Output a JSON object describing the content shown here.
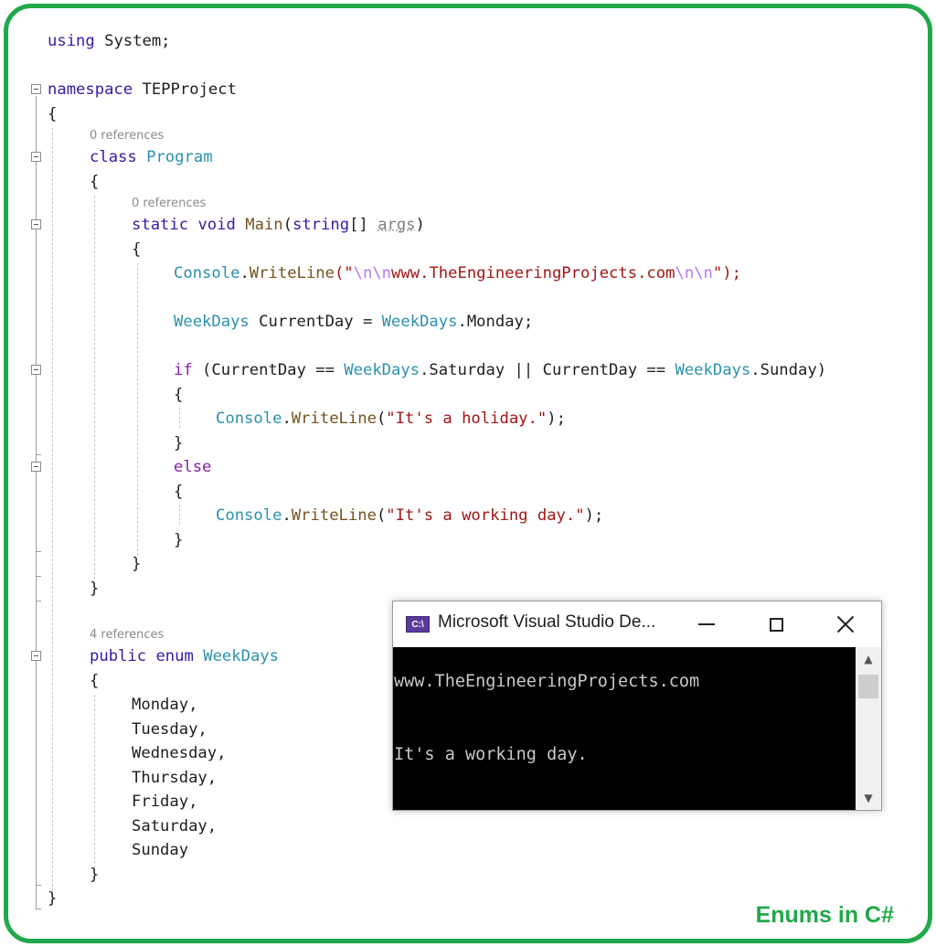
{
  "code": {
    "line_using": [
      "using",
      " System;"
    ],
    "line_namespace": [
      "namespace",
      " TEPProject"
    ],
    "open_brace": "{",
    "close_brace": "}",
    "codelens_program": "0 references",
    "line_class": [
      "class",
      " ",
      "Program"
    ],
    "codelens_main": "0 references",
    "line_main": [
      "static",
      " ",
      "void",
      " ",
      "Main",
      "(",
      "string",
      "[] ",
      "args",
      ")"
    ],
    "line_writeline1": [
      "Console",
      ".",
      "WriteLine",
      "(\"",
      "\\n\\n",
      "www.TheEngineeringProjects.com",
      "\\n\\n",
      "\");"
    ],
    "line_currentday": [
      "WeekDays",
      " CurrentDay = ",
      "WeekDays",
      ".Monday;"
    ],
    "line_if": [
      "if",
      " (CurrentDay == ",
      "WeekDays",
      ".Saturday || CurrentDay == ",
      "WeekDays",
      ".Sunday)"
    ],
    "line_writeline2": [
      "Console",
      ".",
      "WriteLine",
      "(",
      "\"It's a holiday.\"",
      ");"
    ],
    "line_else": "else",
    "line_writeline3": [
      "Console",
      ".",
      "WriteLine",
      "(",
      "\"It's a working day.\"",
      ");"
    ],
    "codelens_enum": "4 references",
    "line_enum": [
      "public",
      " ",
      "enum",
      " ",
      "WeekDays"
    ],
    "enum_members": [
      "Monday,",
      "Tuesday,",
      "Wednesday,",
      "Thursday,",
      "Friday,",
      "Saturday,",
      "Sunday"
    ]
  },
  "console_window": {
    "app_icon_text": "C:\\",
    "title": "Microsoft Visual Studio De...",
    "output_lines": [
      "www.TheEngineeringProjects.com",
      "It's a working day."
    ],
    "scroll_up": "^",
    "scroll_down": "v"
  },
  "footer": {
    "title": "Enums in C#"
  },
  "colors": {
    "frame_green": "#21a84a",
    "keyword": "#3020a8",
    "control_keyword": "#8a1bb0",
    "type": "#2b91af",
    "string": "#a31515"
  }
}
